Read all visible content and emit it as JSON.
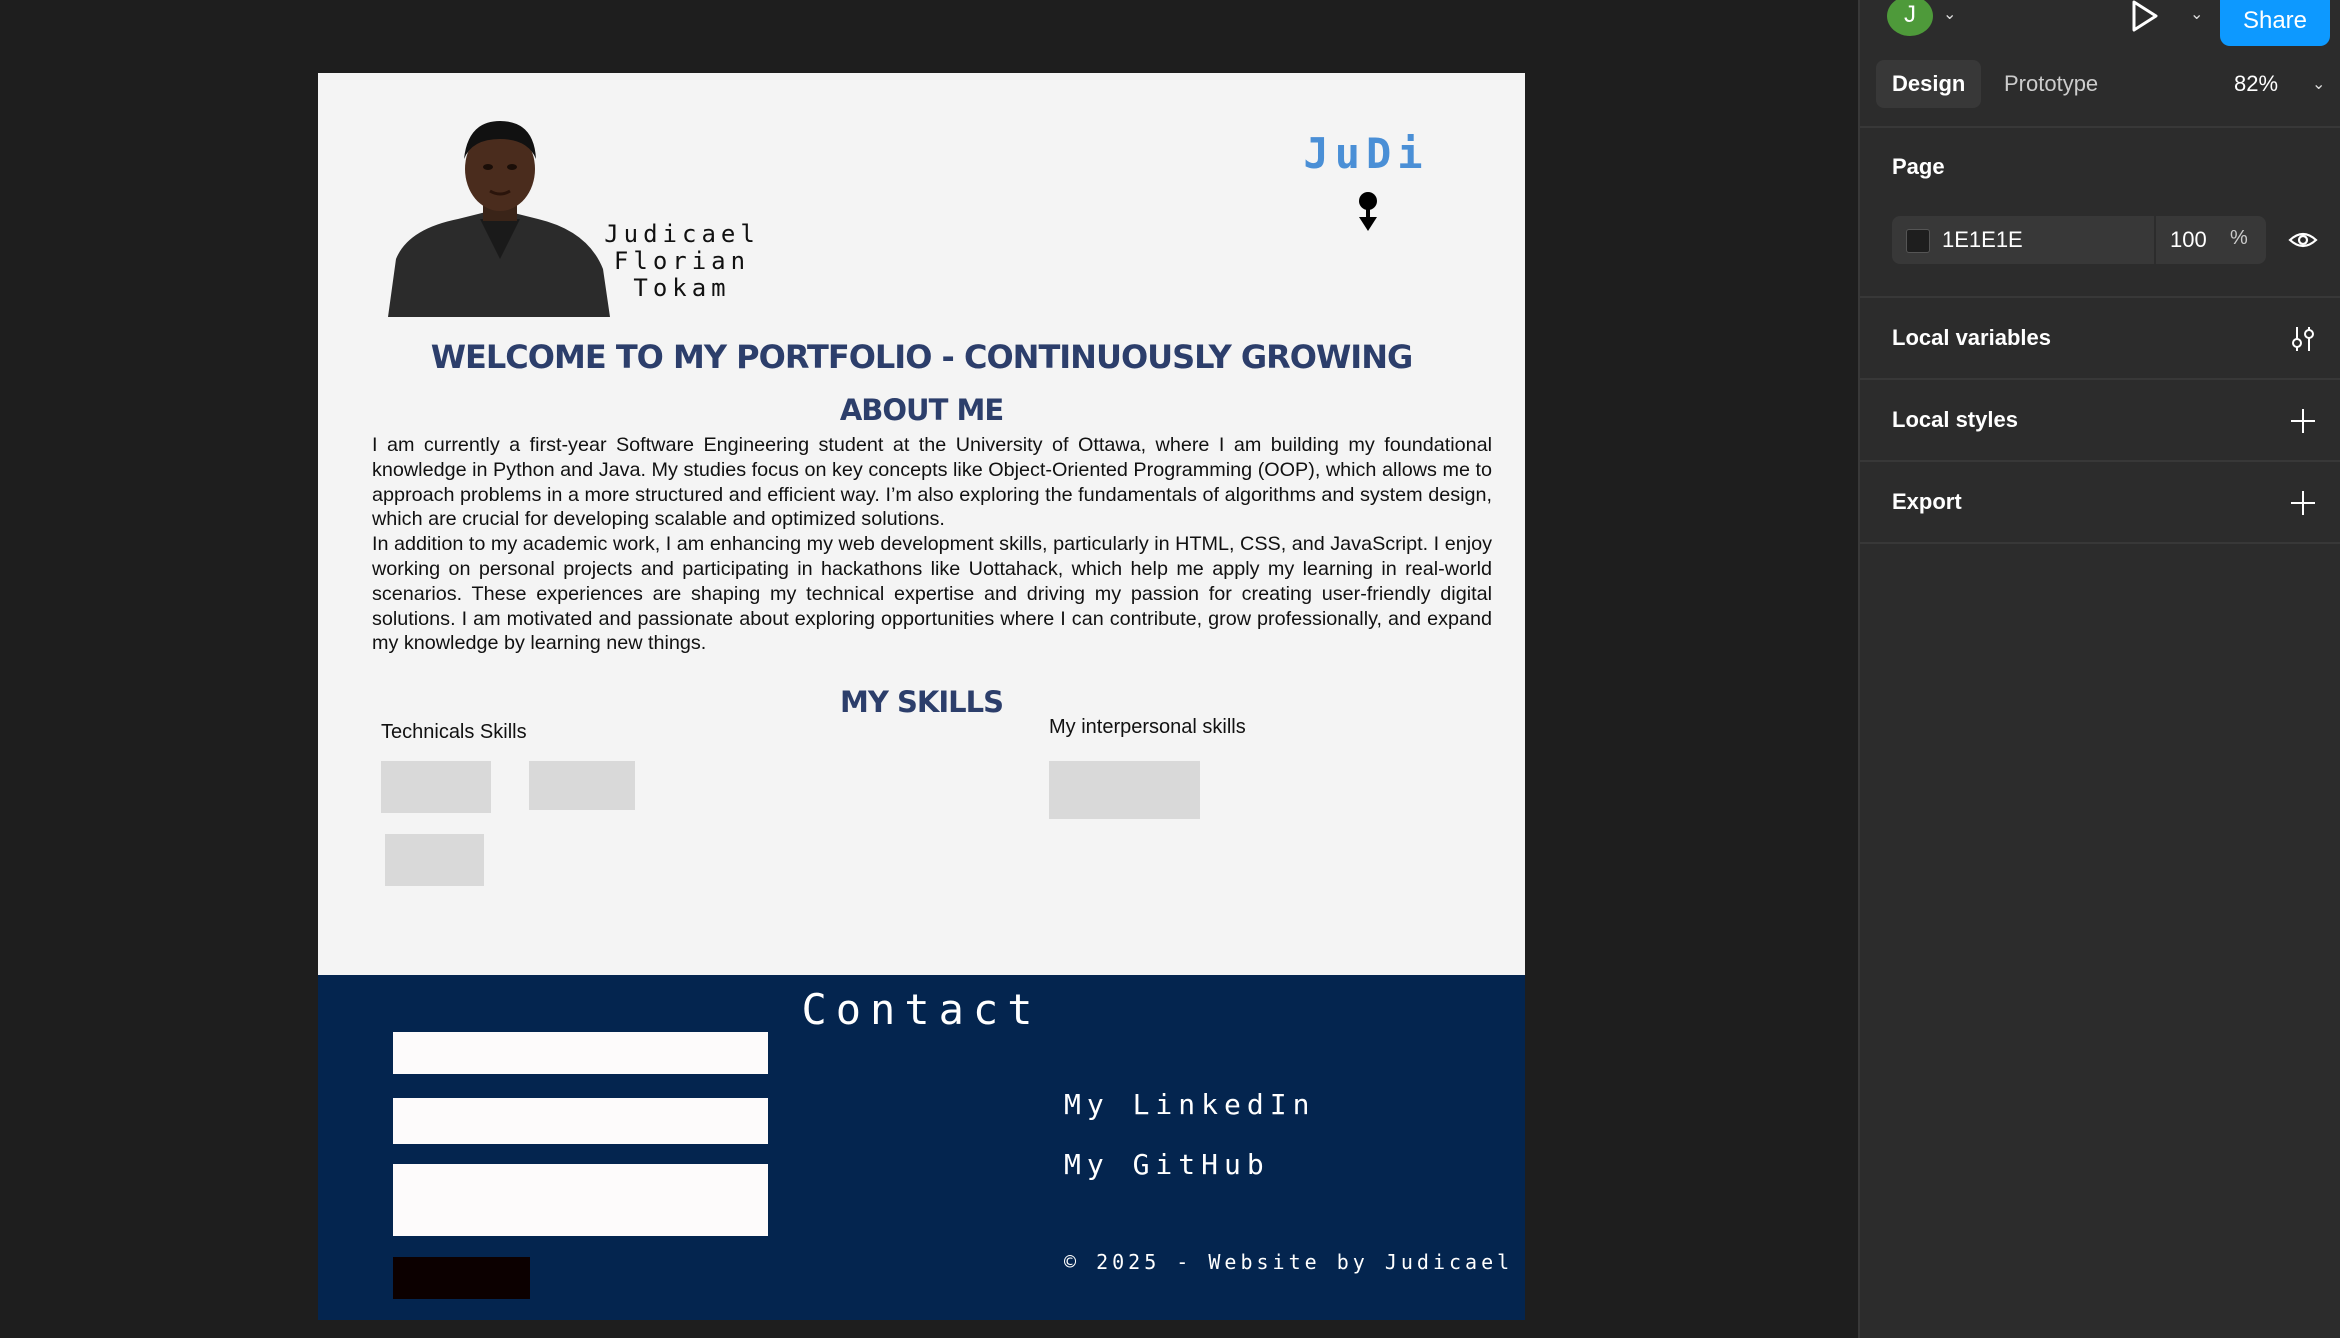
{
  "portfolio": {
    "name_lines": [
      "Judicael",
      "Florian",
      "Tokam"
    ],
    "logo": "JuDi",
    "welcome": "Welcome to my portfolio - continuously growing",
    "about_title": "About Me",
    "about_paragraphs": [
      "I am currently a first-year Software Engineering student at the University of Ottawa, where I am building my foundational knowledge in Python and Java. My studies focus on key concepts like Object-Oriented Programming (OOP), which allows me to approach problems in a more structured and efficient way. I’m also exploring the fundamentals of algorithms and system design, which are crucial for developing scalable and optimized solutions.",
      "In addition to my academic work, I am enhancing my web development skills, particularly in HTML, CSS, and JavaScript. I enjoy working on personal projects and participating in hackathons like Uottahack, which help me apply my learning in real-world scenarios. These experiences are shaping my technical expertise and driving my passion for creating user-friendly digital solutions. I am motivated and passionate about exploring opportunities where I can contribute, grow professionally, and expand my knowledge by learning new things."
    ],
    "skills_title": "My Skills",
    "technical_label": "Technicals Skills",
    "interpersonal_label": "My interpersonal skills",
    "contact": {
      "title": "Contact",
      "linkedin": "My LinkedIn",
      "github": "My GitHub",
      "copyright": "© 2025 - Website by Judicael"
    }
  },
  "panel": {
    "avatar_initial": "J",
    "share_label": "Share",
    "tabs": {
      "design": "Design",
      "prototype": "Prototype"
    },
    "zoom": "82%",
    "page": {
      "title": "Page",
      "color_hex": "1E1E1E",
      "opacity": "100",
      "opacity_unit": "%"
    },
    "sections": {
      "local_variables": "Local variables",
      "local_styles": "Local styles",
      "export": "Export"
    }
  },
  "colors": {
    "canvas_bg": "#1e1e1e",
    "frame_bg": "#f4f4f4",
    "heading": "#2c3e6b",
    "logo": "#4a8fd6",
    "contact_bg": "#04254f",
    "share_blue": "#0d99ff",
    "avatar_green": "#4e9a3a",
    "skill_placeholder": "#d9d9d9"
  }
}
